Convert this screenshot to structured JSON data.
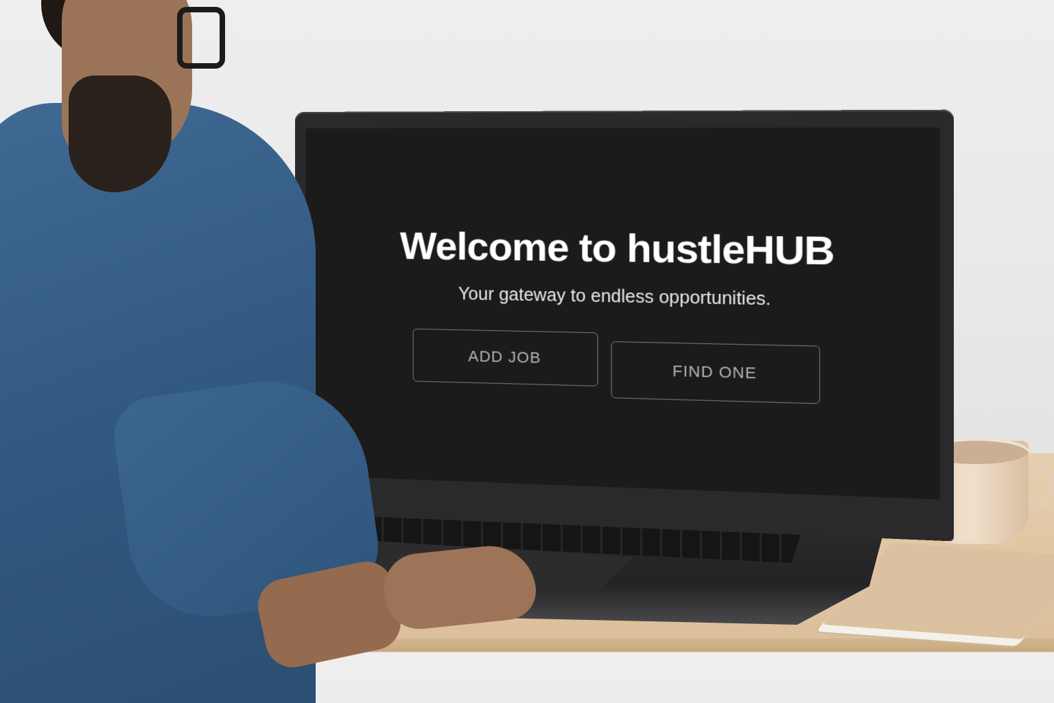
{
  "app": {
    "title": "Welcome to hustleHUB",
    "subtitle": "Your gateway to endless opportunities."
  },
  "actions": {
    "add_job_label": "ADD JOB",
    "find_one_label": "FIND ONE"
  },
  "colors": {
    "screen_background": "#1b1b1b",
    "title_text": "#ffffff",
    "button_border": "#7a7a7a",
    "button_text": "#b3b3b3"
  }
}
